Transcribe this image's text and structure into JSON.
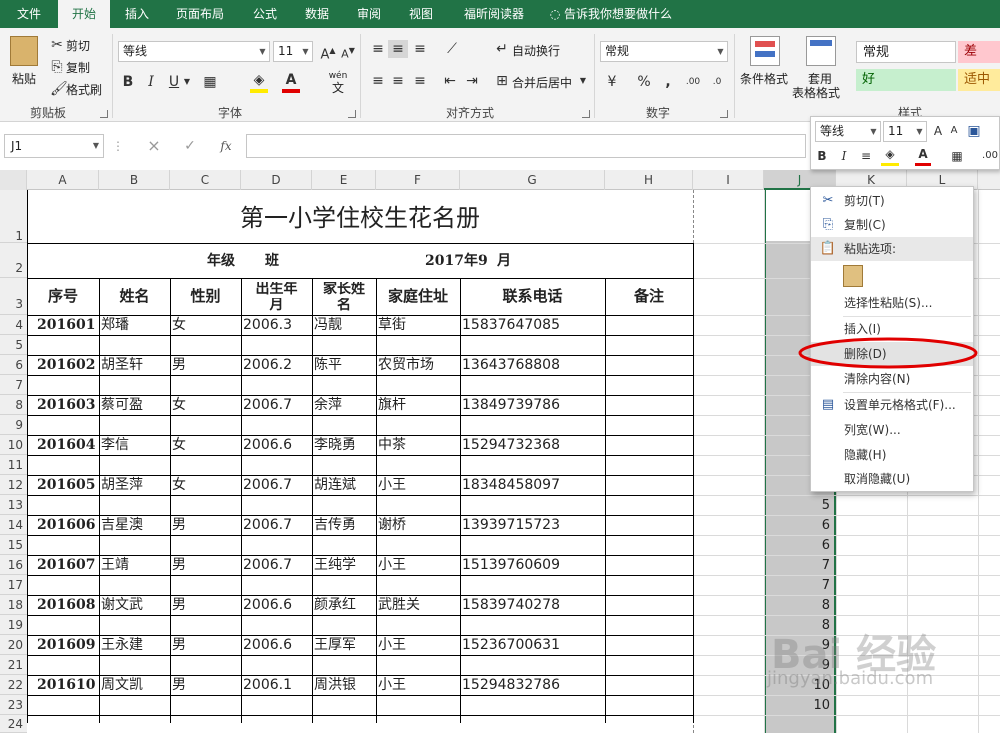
{
  "ribbon_tabs": [
    "文件",
    "开始",
    "插入",
    "页面布局",
    "公式",
    "数据",
    "审阅",
    "视图",
    "福昕阅读器",
    "告诉我你想要做什么"
  ],
  "clipboard": {
    "paste": "粘贴",
    "cut": "剪切",
    "copy": "复制",
    "format_painter": "格式刷",
    "group": "剪贴板"
  },
  "font": {
    "name": "等线",
    "size": "11",
    "bold": "B",
    "italic": "I",
    "underline": "U",
    "wen": "wén",
    "wen_char": "文",
    "group": "字体"
  },
  "alignment": {
    "wrap": "自动换行",
    "merge": "合并后居中",
    "group": "对齐方式"
  },
  "number": {
    "format": "常规",
    "percent": "%",
    "comma": ",",
    "inc": ".00",
    "group": "数字"
  },
  "styles": {
    "cond": "条件格式",
    "table": "套用",
    "table2": "表格格式",
    "normal": "常规",
    "bad": "差",
    "good": "好",
    "neutral": "适中",
    "group": "样式"
  },
  "formula_bar": {
    "name_box": "J1",
    "fx": "fx",
    "cancel": "×",
    "enter": "✓"
  },
  "columns": [
    "A",
    "B",
    "C",
    "D",
    "E",
    "F",
    "G",
    "H",
    "I",
    "J",
    "K",
    "L"
  ],
  "rows": [
    "1",
    "2",
    "3",
    "4",
    "5",
    "6",
    "7",
    "8",
    "9",
    "10",
    "11",
    "12",
    "13",
    "14",
    "15",
    "16",
    "17",
    "18",
    "19",
    "20",
    "21",
    "22",
    "23",
    "24"
  ],
  "sheet": {
    "title": "第一小学住校生花名册",
    "grade_label": "年级",
    "class_label": "班",
    "date_year": "2017年9",
    "date_month": "月",
    "headers": {
      "seq": "序号",
      "name": "姓名",
      "gender": "性别",
      "birth_1": "出生年",
      "birth_2": "月",
      "parent_1": "家长姓",
      "parent_2": "名",
      "address": "家庭住址",
      "phone": "联系电话",
      "remark": "备注"
    },
    "records": [
      {
        "seq": "201601",
        "name": "郑璠",
        "gender": "女",
        "birth": "2006.3",
        "parent": "冯靓",
        "address": "草街",
        "phone": "15837647085"
      },
      {
        "seq": "201602",
        "name": "胡圣轩",
        "gender": "男",
        "birth": "2006.2",
        "parent": "陈平",
        "address": "农贸市场",
        "phone": "13643768808"
      },
      {
        "seq": "201603",
        "name": "蔡可盈",
        "gender": "女",
        "birth": "2006.7",
        "parent": "余萍",
        "address": "旗杆",
        "phone": "13849739786"
      },
      {
        "seq": "201604",
        "name": "李信",
        "gender": "女",
        "birth": "2006.6",
        "parent": "李晓勇",
        "address": "中茶",
        "phone": "15294732368"
      },
      {
        "seq": "201605",
        "name": "胡圣萍",
        "gender": "女",
        "birth": "2006.7",
        "parent": "胡连斌",
        "address": "小王",
        "phone": "18348458097"
      },
      {
        "seq": "201606",
        "name": "吉星澳",
        "gender": "男",
        "birth": "2006.7",
        "parent": "吉传勇",
        "address": "谢桥",
        "phone": "13939715723"
      },
      {
        "seq": "201607",
        "name": "王靖",
        "gender": "男",
        "birth": "2006.7",
        "parent": "王纯学",
        "address": "小王",
        "phone": "15139760609"
      },
      {
        "seq": "201608",
        "name": "谢文武",
        "gender": "男",
        "birth": "2006.6",
        "parent": "颜承红",
        "address": "武胜关",
        "phone": "15839740278"
      },
      {
        "seq": "201609",
        "name": "王永建",
        "gender": "男",
        "birth": "2006.6",
        "parent": "王厚军",
        "address": "小王",
        "phone": "15236700631"
      },
      {
        "seq": "201610",
        "name": "周文凯",
        "gender": "男",
        "birth": "2006.1",
        "parent": "周洪银",
        "address": "小王",
        "phone": "15294832786"
      }
    ],
    "col_j_values": [
      "5",
      "6",
      "6",
      "7",
      "7",
      "8",
      "8",
      "9",
      "9",
      "10",
      "10"
    ]
  },
  "mini_toolbar": {
    "font": "等线",
    "size": "11",
    "bold": "B",
    "italic": "I"
  },
  "context_menu": {
    "cut": "剪切(T)",
    "copy": "复制(C)",
    "paste_options": "粘贴选项:",
    "paste_special": "选择性粘贴(S)...",
    "insert": "插入(I)",
    "delete": "删除(D)",
    "clear": "清除内容(N)",
    "format_cells": "设置单元格格式(F)...",
    "col_width": "列宽(W)...",
    "hide": "隐藏(H)",
    "unhide": "取消隐藏(U)"
  },
  "watermark": {
    "text": "Bai 经验",
    "url": "jingyan.baidu.com"
  },
  "colors": {
    "accent": "#217346",
    "highlight": "#e3e3e3",
    "selected_col": "#c8c8c8",
    "annotation": "#e00000"
  }
}
